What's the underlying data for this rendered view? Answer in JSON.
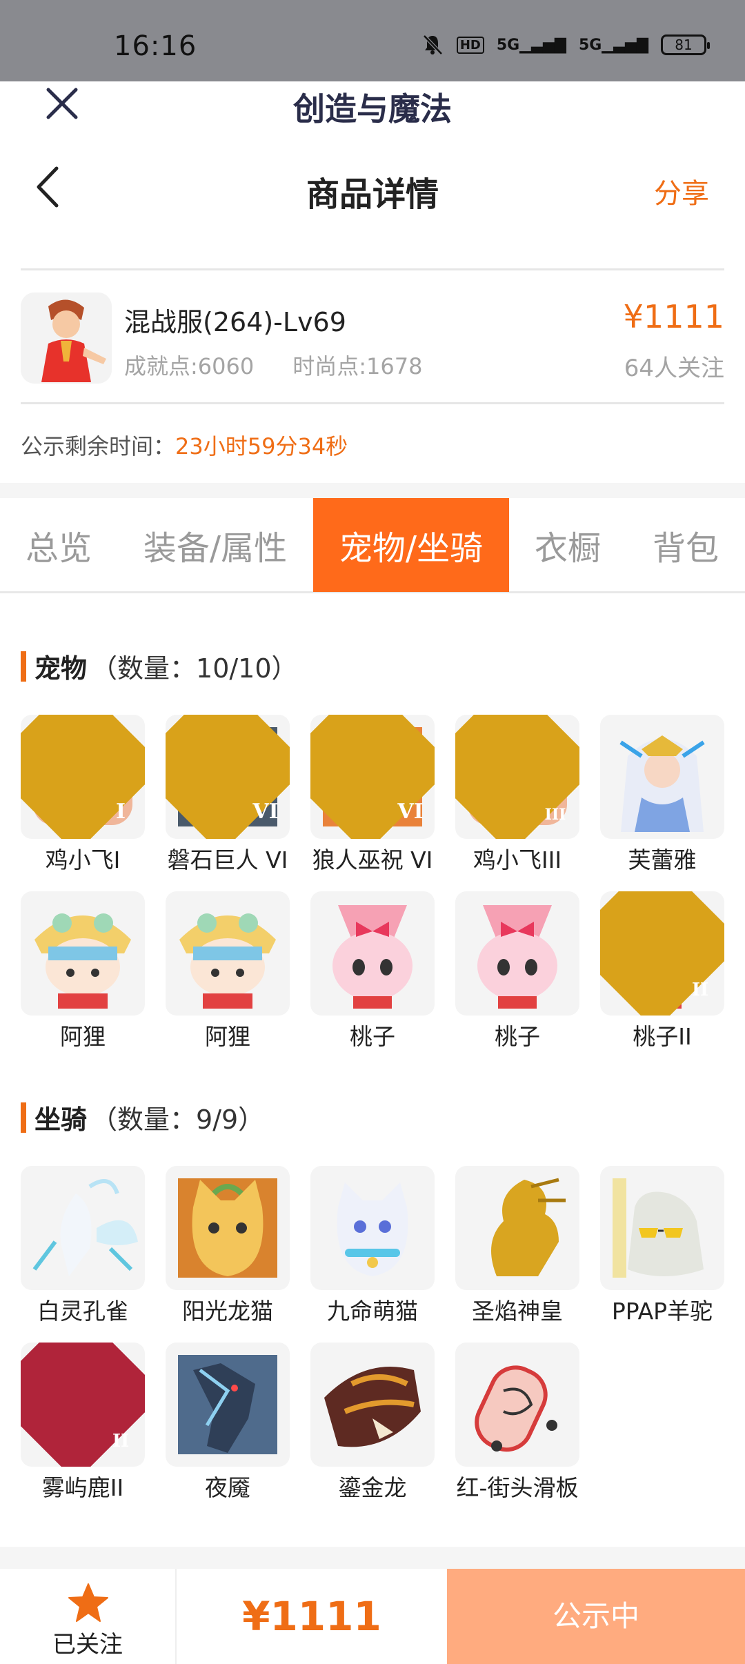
{
  "status_bar": {
    "time": "16:16",
    "hd_label": "HD",
    "net1": "5G",
    "net2": "5G",
    "battery": "81"
  },
  "mini_app": {
    "title": "创造与魔法"
  },
  "nav": {
    "title": "商品详情",
    "share": "分享"
  },
  "product": {
    "name": "混战服(264)-Lv69",
    "achievement": "成就点:6060",
    "fashion": "时尚点:1678",
    "price": "¥1111",
    "followers": "64人关注"
  },
  "countdown": {
    "label": "公示剩余时间：",
    "value": "23小时59分34秒"
  },
  "tabs": [
    {
      "label": "总览"
    },
    {
      "label": "装备/属性"
    },
    {
      "label": "宠物/坐骑"
    },
    {
      "label": "衣橱"
    },
    {
      "label": "背包"
    }
  ],
  "pets": {
    "title": "宠物",
    "count": "（数量：10/10）",
    "items": [
      {
        "name": "鸡小飞I",
        "icon": "chick-pet",
        "badge": "I"
      },
      {
        "name": "磐石巨人 VI",
        "icon": "rock-giant-pet",
        "badge": "VI"
      },
      {
        "name": "狼人巫祝 VI",
        "icon": "werewolf-shaman-pet",
        "badge": "VI"
      },
      {
        "name": "鸡小飞III",
        "icon": "chick-pet",
        "badge": "III"
      },
      {
        "name": "芙蕾雅",
        "icon": "freya-pet",
        "badge": ""
      },
      {
        "name": "阿狸",
        "icon": "ali-pet",
        "badge": ""
      },
      {
        "name": "阿狸",
        "icon": "ali-pet",
        "badge": ""
      },
      {
        "name": "桃子",
        "icon": "peach-bunny-pet",
        "badge": ""
      },
      {
        "name": "桃子",
        "icon": "peach-bunny-pet",
        "badge": ""
      },
      {
        "name": "桃子II",
        "icon": "peach-bunny-pet",
        "badge": "II"
      }
    ]
  },
  "mounts": {
    "title": "坐骑",
    "count": "（数量：9/9）",
    "items": [
      {
        "name": "白灵孔雀",
        "icon": "white-peacock-mount",
        "badge": ""
      },
      {
        "name": "阳光龙猫",
        "icon": "sunny-totoro-mount",
        "badge": ""
      },
      {
        "name": "九命萌猫",
        "icon": "nine-life-cat-mount",
        "badge": ""
      },
      {
        "name": "圣焰神皇",
        "icon": "golden-phoenix-mount",
        "badge": ""
      },
      {
        "name": "PPAP羊驼",
        "icon": "alpaca-mount",
        "badge": ""
      },
      {
        "name": "雾屿鹿II",
        "icon": "mist-deer-mount",
        "badge": "II"
      },
      {
        "name": "夜魇",
        "icon": "nightmare-horse-mount",
        "badge": ""
      },
      {
        "name": "鎏金龙",
        "icon": "gilded-dragon-mount",
        "badge": ""
      },
      {
        "name": "红-街头滑板",
        "icon": "skateboard-mount",
        "badge": ""
      }
    ]
  },
  "bottom_bar": {
    "follow_label": "已关注",
    "price": "¥1111",
    "status": "公示中"
  },
  "colors": {
    "accent": "#ef6d15",
    "tab_active": "#ff6a1a",
    "status_button": "#ffab7f"
  }
}
